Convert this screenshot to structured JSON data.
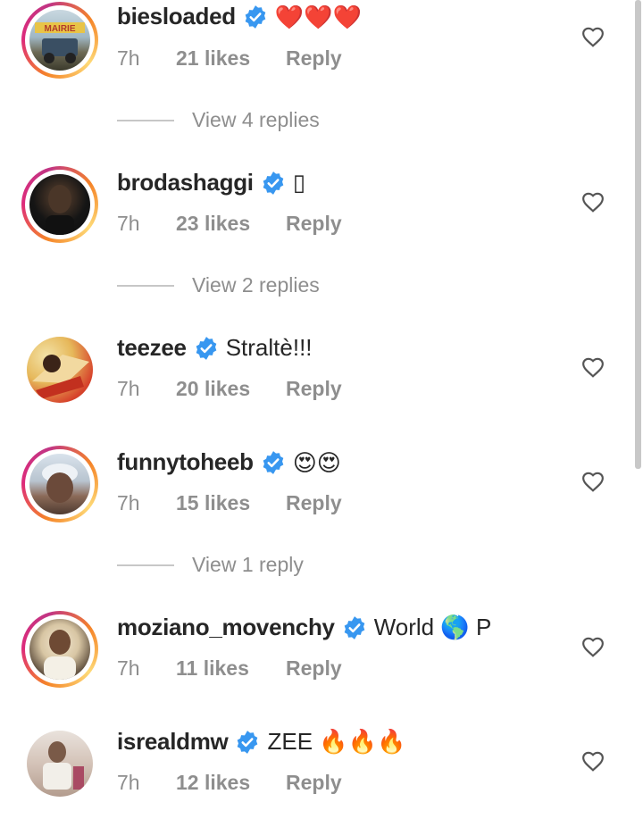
{
  "comments": [
    {
      "username": "biesloaded",
      "text": "❤️❤️❤️",
      "time": "7h",
      "likes": "21 likes",
      "reply": "Reply",
      "view_replies": "View 4 replies",
      "avatar_label": "MAIRIE"
    },
    {
      "username": "brodashaggi",
      "text": "▯",
      "time": "7h",
      "likes": "23 likes",
      "reply": "Reply",
      "view_replies": "View 2 replies"
    },
    {
      "username": "teezee",
      "text": "Straltè!!!",
      "time": "7h",
      "likes": "20 likes",
      "reply": "Reply"
    },
    {
      "username": "funnytoheeb",
      "text": "😍😍",
      "time": "7h",
      "likes": "15 likes",
      "reply": "Reply",
      "view_replies": "View 1 reply"
    },
    {
      "username": "moziano_movenchy",
      "text": "World 🌎 P",
      "time": "7h",
      "likes": "11 likes",
      "reply": "Reply"
    },
    {
      "username": "isrealdmw",
      "text": "ZEE 🔥🔥🔥",
      "time": "7h",
      "likes": "12 likes",
      "reply": "Reply"
    }
  ],
  "icons": {
    "verified": "verified-badge-icon",
    "like": "heart-outline-icon"
  },
  "colors": {
    "verified": "#3897f0",
    "muted": "#8e8e8e",
    "text": "#262626"
  }
}
